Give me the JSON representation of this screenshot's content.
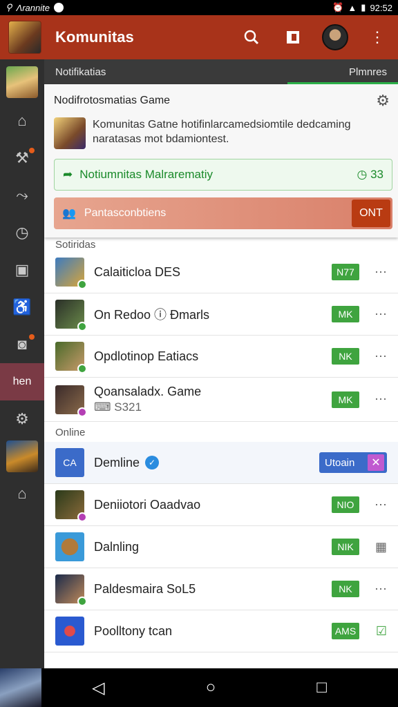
{
  "status": {
    "carrier": "Λrannite",
    "right_text": "92:52"
  },
  "appbar": {
    "title": "Komunitas"
  },
  "subbar": {
    "left_tab": "Notifikatias",
    "right_tab": "Plmnres"
  },
  "panel": {
    "title": "Nodifrotosmatias Game",
    "desc": "Komunitas Gatne hotifinlarcamedsiomtile dedcaming naratasas mot bdamiontest.",
    "notice": {
      "label": "Notiumnitas Malrarematiy",
      "count": "33"
    },
    "promo": {
      "label": "Pantasconbtiens",
      "button": "ONT"
    }
  },
  "sections": {
    "first": "Sotiridas",
    "second": "Online"
  },
  "rows_first": [
    {
      "name": "Calaiticloa DES",
      "tag": "N77",
      "colors": [
        "#3d7bbf",
        "#d8a53a"
      ]
    },
    {
      "name": "On Redoo ⓘ Ðmarls",
      "tag": "MK",
      "colors": [
        "#2a2f28",
        "#6a8a4a"
      ]
    },
    {
      "name": "Opdlotinop Eatiacs",
      "tag": "NK",
      "colors": [
        "#4a6a2a",
        "#c79a6a"
      ]
    },
    {
      "name": "Qoansaladx. Game",
      "sub": "⌨ S321",
      "tag": "MK",
      "colors": [
        "#3a2a2a",
        "#8a6a4a"
      ]
    }
  ],
  "rows_second": [
    {
      "name": "Demline",
      "pill": "Utoain",
      "avatar_text": "CA",
      "colors": [
        "#3b6bc9",
        "#3b6bc9"
      ]
    },
    {
      "name": "Deniiotori Oaadvao",
      "tag": "NIO",
      "colors": [
        "#2a3a1a",
        "#8a6a3a"
      ]
    },
    {
      "name": "Dalnling",
      "tag": "NIK",
      "colors": [
        "#3a9ad9",
        "#b07a3a"
      ]
    },
    {
      "name": "Paldesmaira SoL5",
      "tag": "NK",
      "colors": [
        "#1a2a4a",
        "#c08a5a"
      ]
    },
    {
      "name": "Poolltony tcan",
      "tag": "AMS",
      "colors": [
        "#2a5ad0",
        "#e04a4a"
      ]
    }
  ]
}
